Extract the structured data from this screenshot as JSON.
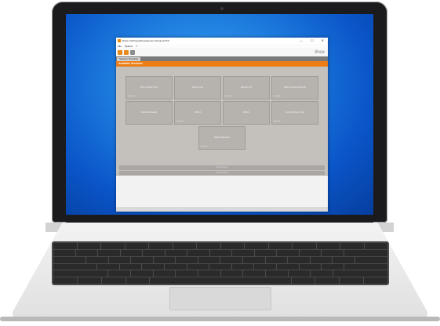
{
  "window": {
    "title": "Draco CON App [Development Version] 6.5.0",
    "minimize": "—",
    "maximize": "☐",
    "close": "✕"
  },
  "menu": {
    "file": "File",
    "options": "Options",
    "help": "?"
  },
  "toolbar": {
    "logo": "ihse"
  },
  "tabs": [
    {
      "label": "Session Overview"
    }
  ],
  "section_header": "Available Sessions",
  "sessions": [
    {
      "name": "Demo Player Test",
      "status": "Available"
    },
    {
      "name": "Dream Live",
      "status": ""
    },
    {
      "name": "Sheshmi v1",
      "status": "Available"
    },
    {
      "name": "Web Consent Portal B",
      "status": "Available"
    },
    {
      "name": "Web Dashboard",
      "status": ""
    },
    {
      "name": "CBS 2",
      "status": "Available"
    },
    {
      "name": "CBS 3",
      "status": ""
    },
    {
      "name": "Control Player Grid",
      "status": "Available"
    },
    {
      "name": "Deluxel Rumors",
      "status": "Available"
    }
  ],
  "buttons": {
    "start": "Start Session",
    "stop": "Stop Session"
  },
  "colors": {
    "accent": "#ec7d15",
    "tile": "#b6b2ae",
    "desktop": "#1f7fe0"
  }
}
